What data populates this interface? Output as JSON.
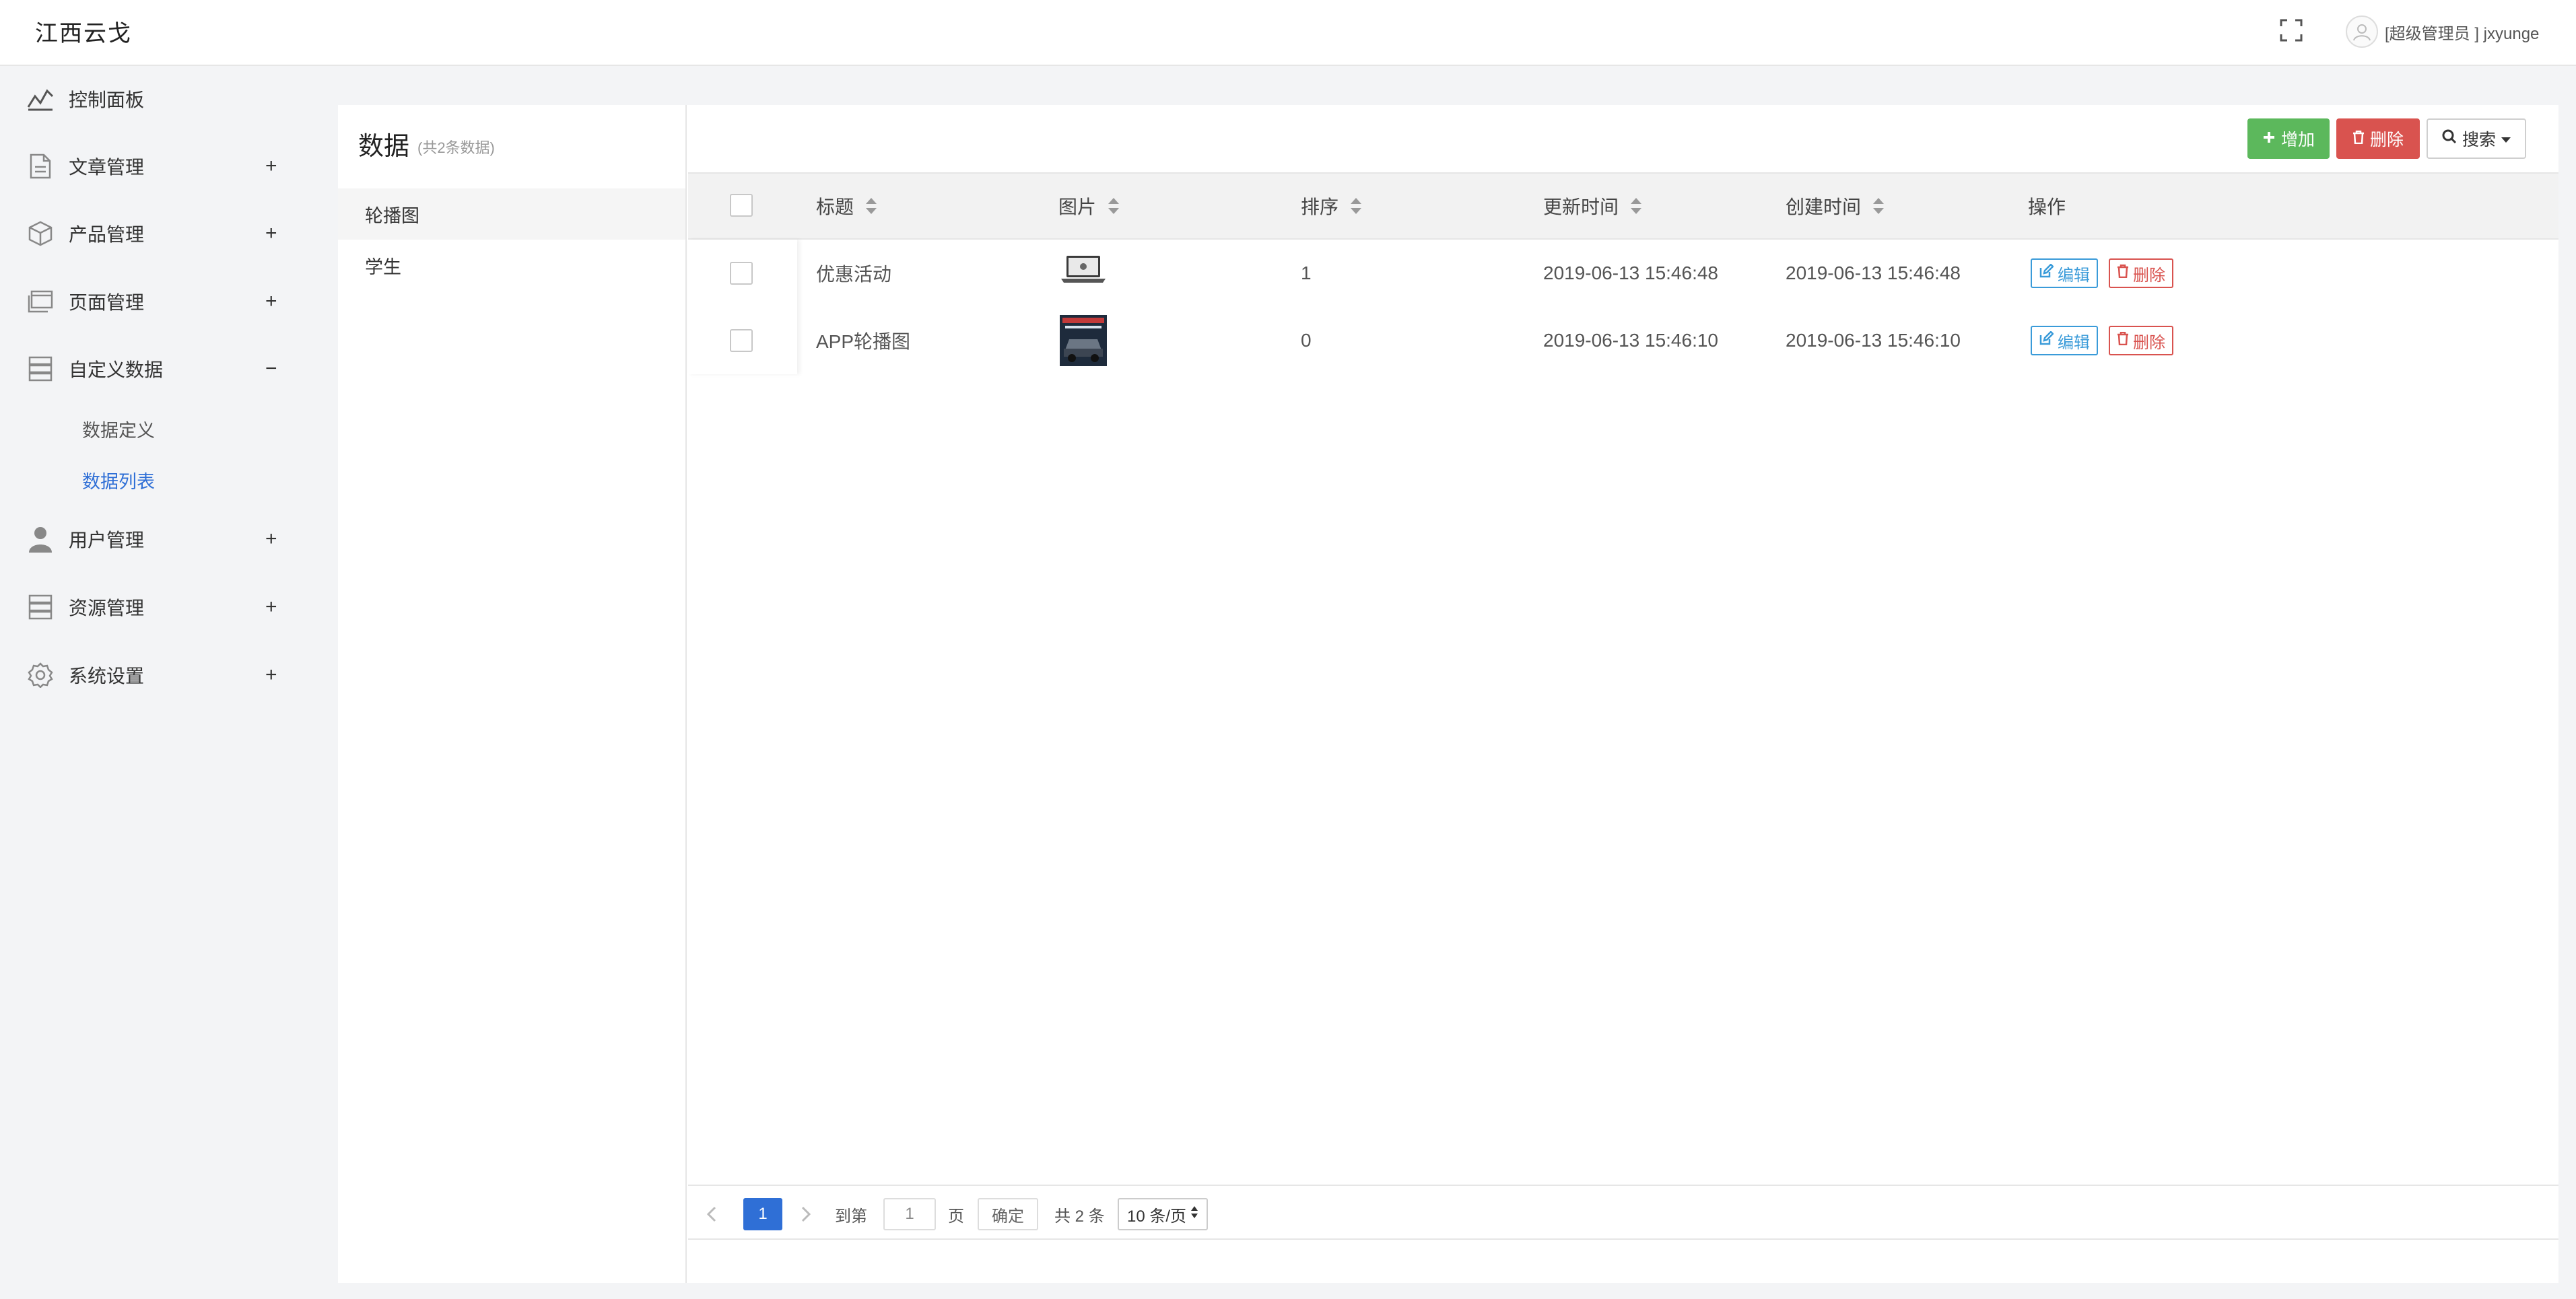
{
  "header": {
    "brand": "江西云戈",
    "user": "[超级管理员 ] jxyunge"
  },
  "sidebar": {
    "items": [
      {
        "label": "控制面板",
        "icon": "chart-line-icon"
      },
      {
        "label": "文章管理",
        "icon": "document-icon",
        "toggle": "+"
      },
      {
        "label": "产品管理",
        "icon": "cube-icon",
        "toggle": "+"
      },
      {
        "label": "页面管理",
        "icon": "window-icon",
        "toggle": "+"
      },
      {
        "label": "自定义数据",
        "icon": "database-icon",
        "toggle": "−"
      },
      {
        "label": "用户管理",
        "icon": "user-icon",
        "toggle": "+"
      },
      {
        "label": "资源管理",
        "icon": "storage-icon",
        "toggle": "+"
      },
      {
        "label": "系统设置",
        "icon": "gear-icon",
        "toggle": "+"
      }
    ],
    "subitems": [
      {
        "label": "数据定义"
      },
      {
        "label": "数据列表"
      }
    ]
  },
  "left_panel": {
    "title": "数据",
    "subtitle": "(共2条数据)",
    "categories": [
      {
        "label": "轮播图"
      },
      {
        "label": "学生"
      }
    ]
  },
  "toolbar": {
    "add_label": "增加",
    "delete_label": "删除",
    "search_label": "搜索"
  },
  "table": {
    "columns": [
      "标题",
      "图片",
      "排序",
      "更新时间",
      "创建时间",
      "操作"
    ],
    "rows": [
      {
        "title": "优惠活动",
        "image": "laptop-thumbnail",
        "sort": "1",
        "updated": "2019-06-13 15:46:48",
        "created": "2019-06-13 15:46:48"
      },
      {
        "title": "APP轮播图",
        "image": "car-poster-thumbnail",
        "sort": "0",
        "updated": "2019-06-13 15:46:10",
        "created": "2019-06-13 15:46:10"
      }
    ],
    "edit_label": "编辑",
    "delete_label": "删除"
  },
  "pagination": {
    "current_page": "1",
    "goto_label": "到第",
    "goto_value": "1",
    "page_unit": "页",
    "confirm_label": "确定",
    "total_text": "共 2 条",
    "page_size": "10 条/页"
  },
  "colors": {
    "accent": "#2f6fd6",
    "success": "#5cb85c",
    "danger": "#d9534f",
    "info": "#3a9bd9"
  }
}
